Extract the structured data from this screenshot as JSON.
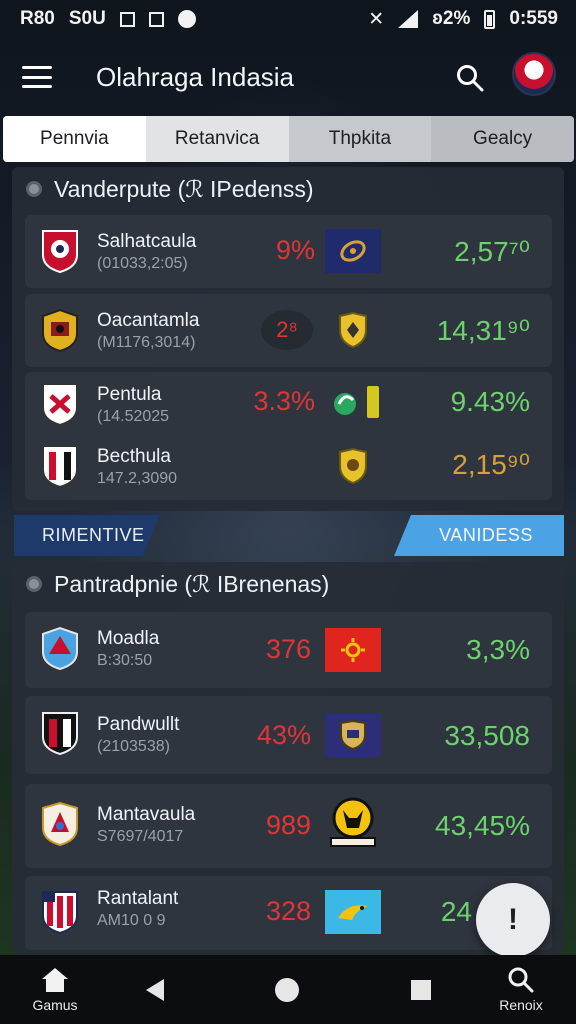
{
  "status_bar": {
    "left_text_1": "R80",
    "left_text_2": "S0U",
    "right_battery": "ʚ2%",
    "time": "0:559"
  },
  "app_bar": {
    "title": "Olahraga Indasia"
  },
  "tabs": [
    {
      "label": "Pennvia"
    },
    {
      "label": "Retanvica"
    },
    {
      "label": "Thpkita"
    },
    {
      "label": "Gealcy"
    }
  ],
  "section1": {
    "title": "Vanderpute (ℛ IPedenss)",
    "rows": [
      {
        "name": "Salhatcaula",
        "sub": "(01033,2:05)",
        "pct": "9%",
        "value": "2,57⁷⁰",
        "value_color": "green",
        "icon": "globe-icon"
      },
      {
        "name": "Oacantamla",
        "sub": "(M1176,3014)",
        "pct": "2⁸",
        "value": "14,31⁹⁰",
        "value_color": "green",
        "icon": "shield-icon"
      },
      {
        "name": "Pentula",
        "sub": "(14.52025",
        "pct": "3.3%",
        "value": "9.43%",
        "value_color": "green",
        "icon": "leaf-icon"
      },
      {
        "name": "Becthula",
        "sub": "147.2,3090",
        "pct": "",
        "value": "2,15⁹⁰",
        "value_color": "gold",
        "icon": "crest-icon"
      }
    ]
  },
  "banner": {
    "left": "RIMENTIVE",
    "right": "VANIDESS"
  },
  "section2": {
    "title": "Pantradpnie (ℛ IBrenenas)",
    "rows": [
      {
        "name": "Moadla",
        "sub": "B:30:50",
        "pct": "376",
        "value": "3,3%",
        "icon": "sun-icon"
      },
      {
        "name": "Pandwullt",
        "sub": "(2103538)",
        "pct": "43%",
        "value": "33,508",
        "icon": "badge-icon"
      },
      {
        "name": "Mantavaula",
        "sub": "S7697/4017",
        "pct": "989",
        "value": "43,45%",
        "icon": "bull-icon"
      },
      {
        "name": "Rantalant",
        "sub": "AM10 0 9",
        "pct": "328",
        "value": "24",
        "icon": "bird-icon"
      }
    ]
  },
  "fab": {
    "label": "!"
  },
  "bottom_nav": [
    {
      "label": "Gamus",
      "icon": "home-icon"
    },
    {
      "label": "",
      "icon": "back-icon"
    },
    {
      "label": "",
      "icon": "circle-icon"
    },
    {
      "label": "",
      "icon": "square-icon"
    },
    {
      "label": "Renoix",
      "icon": "search-icon"
    }
  ],
  "colors": {
    "positive": "#6cd36c",
    "negative": "#e03535",
    "gold": "#d6a13b",
    "accent_blue": "#4ba3e6"
  }
}
